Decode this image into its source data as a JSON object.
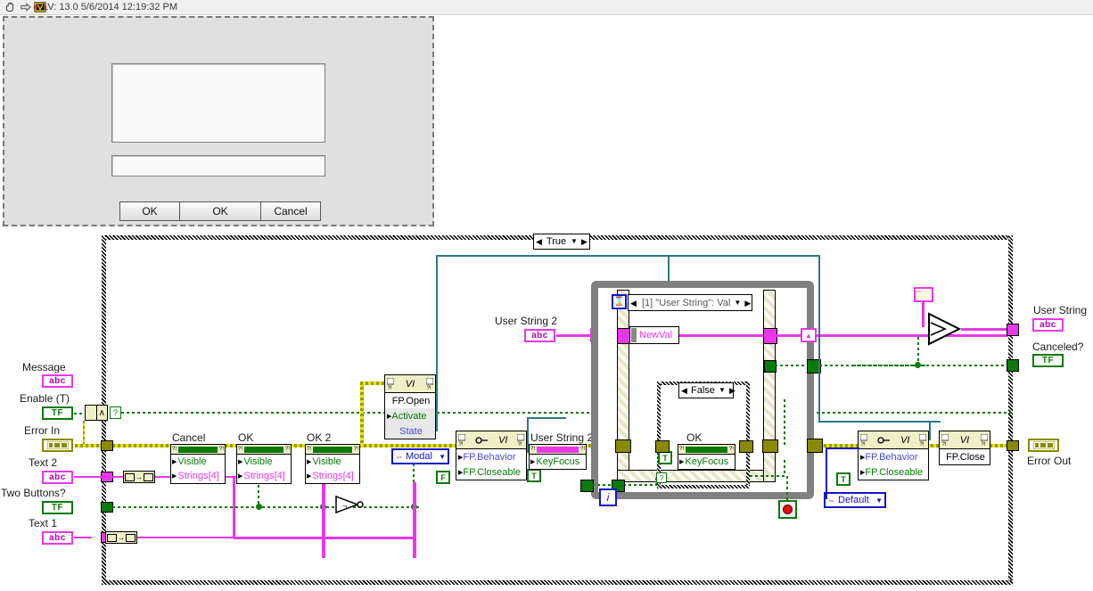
{
  "titlebar": {
    "text": "LV: 13.0 5/6/2014 12:19:32 PM",
    "icons": [
      "hand-icon",
      "arrow-icon",
      "labview-vi-icon"
    ]
  },
  "front_panel": {
    "name": "front-panel-preview",
    "string_display": {
      "value": ""
    },
    "string_input": {
      "value": "",
      "placeholder": ""
    },
    "buttons": [
      {
        "label": "OK"
      },
      {
        "label": "OK"
      },
      {
        "label": "Cancel"
      }
    ]
  },
  "block_diagram": {
    "case_structure": {
      "selector": "True",
      "left_arrow": "◀",
      "right_arrow": "▶",
      "drop": "▼"
    },
    "inner_case_structure": {
      "selector": "False",
      "left_arrow": "◀",
      "right_arrow": "▶",
      "drop": "▼"
    },
    "event_structure": {
      "case_label": "[1] \"User String\": Val",
      "left_arrow": "◀",
      "right_arrow": "▶",
      "drop": "▼",
      "timeout_icon": "hourglass-icon",
      "event_data_node": "NewVal",
      "iteration_terminal": "i",
      "stop_button": "stop-button"
    },
    "input_terminals": [
      {
        "label": "Message",
        "glyph": "abc",
        "type": "string"
      },
      {
        "label": "Enable (T)",
        "glyph": "TF",
        "type": "boolean"
      },
      {
        "label": "Error In",
        "glyph": "",
        "type": "error"
      },
      {
        "label": "Text 2",
        "glyph": "abc",
        "type": "string"
      },
      {
        "label": "Two Buttons?",
        "glyph": "TF",
        "type": "boolean"
      },
      {
        "label": "Text 1",
        "glyph": "abc",
        "type": "string"
      }
    ],
    "output_terminals": [
      {
        "label": "User String",
        "glyph": "abc",
        "type": "string"
      },
      {
        "label": "Canceled?",
        "glyph": "TF",
        "type": "boolean"
      },
      {
        "label": "Error Out",
        "glyph": "",
        "type": "error"
      }
    ],
    "property_nodes": [
      {
        "label": "Cancel",
        "rows": [
          {
            "text": "Visible",
            "color": "g"
          },
          {
            "text": "Strings[4]",
            "color": "m"
          }
        ]
      },
      {
        "label": "OK",
        "rows": [
          {
            "text": "Visible",
            "color": "g"
          },
          {
            "text": "Strings[4]",
            "color": "m"
          }
        ]
      },
      {
        "label": "OK 2",
        "rows": [
          {
            "text": "Visible",
            "color": "g"
          },
          {
            "text": "Strings[4]",
            "color": "m"
          }
        ]
      },
      {
        "label": "User String 2",
        "rows": [
          {
            "text": "KeyFocus",
            "color": "g"
          }
        ]
      },
      {
        "label": "OK",
        "rows": [
          {
            "text": "KeyFocus",
            "color": "g"
          }
        ]
      }
    ],
    "vi_nodes": [
      {
        "title": "VI",
        "method": "FP.Open",
        "rows": [
          {
            "text": "Activate",
            "color": "g"
          },
          {
            "text": "State",
            "color": "b"
          }
        ],
        "kind": "invoke"
      },
      {
        "title": "VI",
        "method": "",
        "rows": [
          {
            "text": "FP.Behavior",
            "color": "b"
          },
          {
            "text": "FP.Closeable",
            "color": "g"
          }
        ],
        "kind": "property"
      },
      {
        "title": "VI",
        "method": "",
        "rows": [
          {
            "text": "FP.Behavior",
            "color": "b"
          },
          {
            "text": "FP.Closeable",
            "color": "g"
          }
        ],
        "kind": "property"
      },
      {
        "title": "VI",
        "method": "FP.Close",
        "rows": [],
        "kind": "invoke"
      }
    ],
    "constants": [
      {
        "kind": "enum",
        "value": "Modal"
      },
      {
        "kind": "enum",
        "value": "Default"
      },
      {
        "kind": "bool",
        "value": "F"
      },
      {
        "kind": "bool",
        "value": "T"
      },
      {
        "kind": "bool",
        "value": "T"
      },
      {
        "kind": "string",
        "value": ""
      }
    ],
    "labels": {
      "user_string_2_top": "User String 2",
      "user_string_2_prop": "User String 2",
      "ok_prop": "OK"
    },
    "functions": [
      {
        "name": "and-array-elements",
        "glyph": "∧"
      },
      {
        "name": "not-gate",
        "glyph": "¬"
      },
      {
        "name": "select-function",
        "glyph": ""
      },
      {
        "name": "build-array-1",
        "glyph": "→"
      },
      {
        "name": "build-array-2",
        "glyph": "→"
      },
      {
        "name": "unbundle-error",
        "glyph": "?"
      }
    ]
  },
  "colors": {
    "string_wire": "#e838e8",
    "boolean_wire": "#0a7a0a",
    "error_wire": "#e6e600",
    "refnum_wire": "#2a7a80",
    "structure_gray": "#808080"
  }
}
